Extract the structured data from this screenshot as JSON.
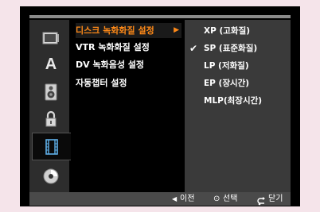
{
  "menu": {
    "items": [
      {
        "label": "디스크 녹화화질 설정",
        "active": true
      },
      {
        "label": "VTR 녹화화질 설정"
      },
      {
        "label": "DV 녹화음성 설정"
      },
      {
        "label": "자동챕터 설정"
      }
    ]
  },
  "options": {
    "items": [
      {
        "label": "XP (고화질)"
      },
      {
        "label": "SP (표준화질)",
        "checked": true
      },
      {
        "label": "LP (저화질)"
      },
      {
        "label": "EP (장시간)"
      },
      {
        "label": "MLP(최장시간)"
      }
    ],
    "check_mark": "✔"
  },
  "sidebar_icons": [
    {
      "name": "tv-icon"
    },
    {
      "name": "language-icon",
      "glyph": "A"
    },
    {
      "name": "speaker-icon"
    },
    {
      "name": "lock-icon"
    },
    {
      "name": "film-icon",
      "selected": true
    },
    {
      "name": "disc-icon"
    }
  ],
  "footer": {
    "prev_glyph": "◀",
    "prev_label": "이전",
    "select_glyph": "⊙",
    "select_label": "선택",
    "close_label": "닫기"
  },
  "colors": {
    "accent": "#ff8a18",
    "panel": "#3a3a3a",
    "sidebar": "#2d2d2d",
    "bar": "#4a4a4a"
  }
}
